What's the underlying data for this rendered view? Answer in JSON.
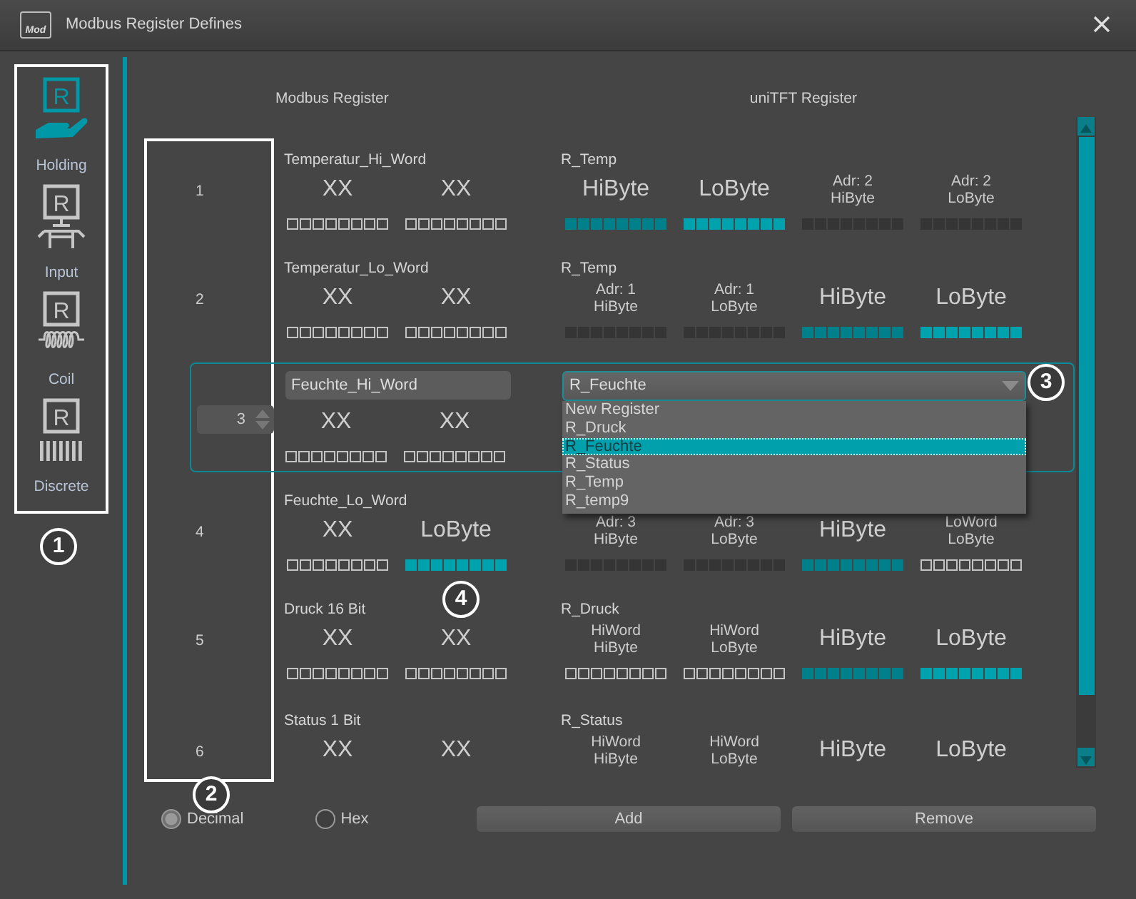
{
  "window": {
    "title": "Modbus Register Defines",
    "icon_label": "Mod"
  },
  "sidebar": {
    "items": [
      {
        "kind": "holding",
        "icon_letter": "R",
        "label": "Holding",
        "selected": true
      },
      {
        "kind": "input",
        "icon_letter": "R",
        "label": "Input",
        "selected": false
      },
      {
        "kind": "coil",
        "icon_letter": "R",
        "label": "Coil",
        "selected": false
      },
      {
        "kind": "discrete",
        "icon_letter": "R",
        "label": "Discrete",
        "selected": false
      }
    ]
  },
  "headers": {
    "modbus": "Modbus Register",
    "unitft": "uniTFT Register"
  },
  "rows": [
    {
      "kind": "view",
      "number": "1",
      "modbus_name": "Temperatur_Hi_Word",
      "modbus_cells": [
        {
          "lines": [
            "XX"
          ],
          "bits_filled": false
        },
        {
          "lines": [
            "XX"
          ],
          "bits_filled": false
        }
      ],
      "unitft_name": "R_Temp",
      "unitft_cells": [
        {
          "lines": [
            "HiByte"
          ],
          "bits_filled": true,
          "color": "#00808b"
        },
        {
          "lines": [
            "LoByte"
          ],
          "bits_filled": true,
          "color": "#00a2ae"
        },
        {
          "lines": [
            "Adr: 2",
            "HiByte"
          ],
          "bits_filled": true,
          "color": "#353535"
        },
        {
          "lines": [
            "Adr: 2",
            "LoByte"
          ],
          "bits_filled": true,
          "color": "#353535"
        }
      ]
    },
    {
      "kind": "view",
      "number": "2",
      "modbus_name": "Temperatur_Lo_Word",
      "modbus_cells": [
        {
          "lines": [
            "XX"
          ],
          "bits_filled": false
        },
        {
          "lines": [
            "XX"
          ],
          "bits_filled": false
        }
      ],
      "unitft_name": "R_Temp",
      "unitft_cells": [
        {
          "lines": [
            "Adr: 1",
            "HiByte"
          ],
          "bits_filled": true,
          "color": "#353535"
        },
        {
          "lines": [
            "Adr: 1",
            "LoByte"
          ],
          "bits_filled": true,
          "color": "#353535"
        },
        {
          "lines": [
            "HiByte"
          ],
          "bits_filled": true,
          "color": "#00808b"
        },
        {
          "lines": [
            "LoByte"
          ],
          "bits_filled": true,
          "color": "#00a2ae"
        }
      ]
    },
    {
      "kind": "edit",
      "number": "3",
      "name_value": "Feuchte_Hi_Word",
      "modbus_cells": [
        {
          "lines": [
            "XX"
          ],
          "bits_filled": false
        },
        {
          "lines": [
            "XX"
          ],
          "bits_filled": false
        }
      ],
      "combo_value": "R_Feuchte",
      "options": [
        {
          "label": "New Register",
          "selected": false
        },
        {
          "label": "R_Druck",
          "selected": false
        },
        {
          "label": "R_Feuchte",
          "selected": true
        },
        {
          "label": "R_Status",
          "selected": false
        },
        {
          "label": "R_Temp",
          "selected": false
        },
        {
          "label": "R_temp9",
          "selected": false
        }
      ]
    },
    {
      "kind": "view",
      "number": "4",
      "modbus_name": "Feuchte_Lo_Word",
      "modbus_cells": [
        {
          "lines": [
            "XX"
          ],
          "bits_filled": false
        },
        {
          "lines": [
            "LoByte"
          ],
          "bits_filled": true,
          "color": "#00a2ae"
        }
      ],
      "unitft_cells": [
        {
          "lines": [
            "Adr: 3",
            "HiByte"
          ],
          "bits_filled": true,
          "color": "#353535"
        },
        {
          "lines": [
            "Adr: 3",
            "LoByte"
          ],
          "bits_filled": true,
          "color": "#353535"
        },
        {
          "lines": [
            "HiByte"
          ],
          "bits_filled": true,
          "color": "#00808b"
        },
        {
          "lines": [
            "LoWord",
            "LoByte"
          ],
          "bits_filled": false
        }
      ]
    },
    {
      "kind": "view",
      "number": "5",
      "modbus_name": "Druck 16 Bit",
      "modbus_cells": [
        {
          "lines": [
            "XX"
          ],
          "bits_filled": false
        },
        {
          "lines": [
            "XX"
          ],
          "bits_filled": false
        }
      ],
      "unitft_name": "R_Druck",
      "unitft_cells": [
        {
          "lines": [
            "HiWord",
            "HiByte"
          ],
          "bits_filled": false
        },
        {
          "lines": [
            "HiWord",
            "LoByte"
          ],
          "bits_filled": false
        },
        {
          "lines": [
            "HiByte"
          ],
          "bits_filled": true,
          "color": "#00808b"
        },
        {
          "lines": [
            "LoByte"
          ],
          "bits_filled": true,
          "color": "#00a2ae"
        }
      ]
    },
    {
      "kind": "view",
      "number": "6",
      "modbus_name": "Status 1 Bit",
      "modbus_cells": [
        {
          "lines": [
            "XX"
          ]
        },
        {
          "lines": [
            "XX"
          ]
        }
      ],
      "unitft_name": "R_Status",
      "unitft_cells": [
        {
          "lines": [
            "HiWord",
            "HiByte"
          ]
        },
        {
          "lines": [
            "HiWord",
            "LoByte"
          ]
        },
        {
          "lines": [
            "HiByte"
          ]
        },
        {
          "lines": [
            "LoByte"
          ]
        }
      ]
    }
  ],
  "number_format": [
    {
      "label": "Decimal",
      "selected": true
    },
    {
      "label": "Hex",
      "selected": false
    }
  ],
  "buttons": [
    "Add",
    "Remove"
  ],
  "callouts": [
    "1",
    "2",
    "3",
    "4"
  ]
}
